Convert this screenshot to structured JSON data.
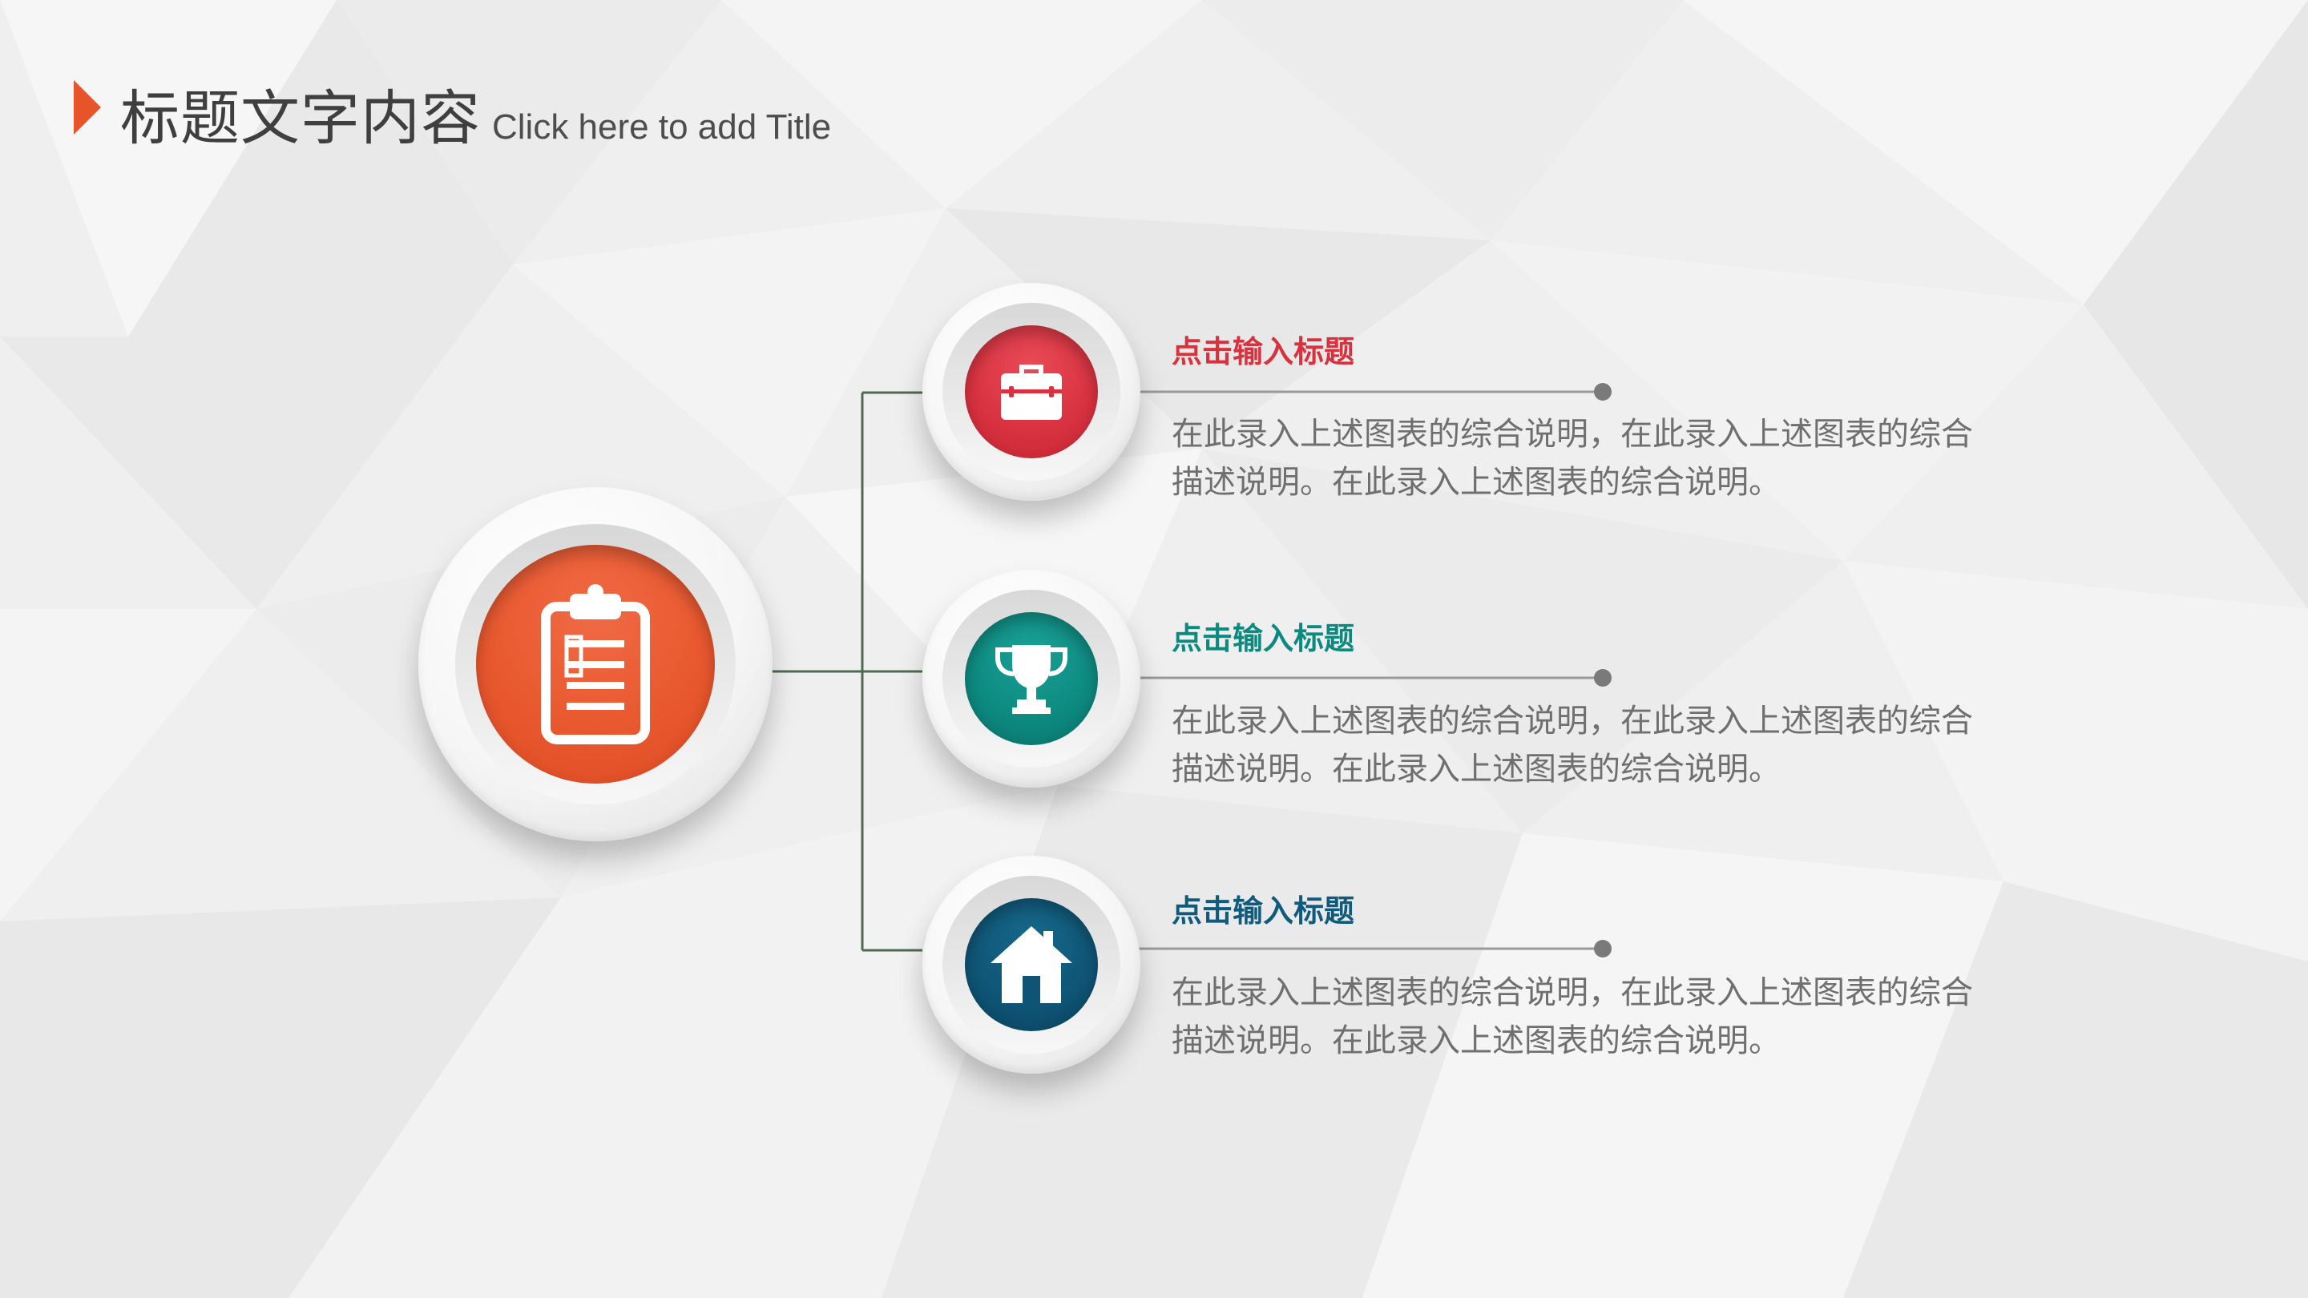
{
  "slide": {
    "title_cn": "标题文字内容",
    "title_en": "Click here to add Title"
  },
  "hub": {
    "icon": "clipboard-icon",
    "color": "#e9582f"
  },
  "items": [
    {
      "heading": "点击输入标题",
      "body": "在此录入上述图表的综合说明，在此录入上述图表的综合描述说明。在此录入上述图表的综合说明。",
      "icon": "toolbox-icon",
      "color": "#d8323e"
    },
    {
      "heading": "点击输入标题",
      "body": "在此录入上述图表的综合说明，在此录入上述图表的综合描述说明。在此录入上述图表的综合说明。",
      "icon": "trophy-icon",
      "color": "#0d8a80"
    },
    {
      "heading": "点击输入标题",
      "body": "在此录入上述图表的综合说明，在此录入上述图表的综合描述说明。在此录入上述图表的综合说明。",
      "icon": "house-icon",
      "color": "#0f5b7d"
    }
  ],
  "colors": {
    "accent": "#e8542a",
    "connector": "#4f6a52",
    "rule": "#9a9a9a"
  }
}
